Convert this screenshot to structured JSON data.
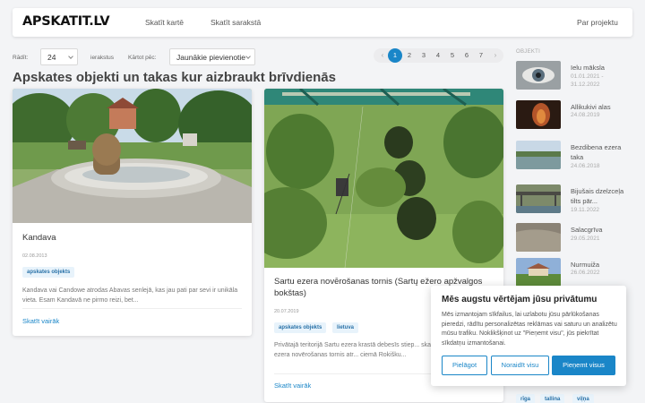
{
  "header": {
    "logo": "APSKATIT.LV",
    "nav": [
      "Skatīt kartē",
      "Skatīt sarakstā"
    ],
    "about": "Par projektu"
  },
  "controls": {
    "show_label": "Rādīt:",
    "show_value": "24",
    "show_suffix": "ierakstus",
    "sort_label": "Kārtot pēc:",
    "sort_value": "Jaunākie pievienotie"
  },
  "pagination": {
    "prev": "‹",
    "pages": [
      "1",
      "2",
      "3",
      "4",
      "5",
      "6",
      "7"
    ],
    "next": "›",
    "active_page": "1"
  },
  "page_title": "Apskates objekti un takas kur aizbraukt brīvdienās",
  "cards": [
    {
      "title": "Kandava",
      "date": "02.08.2013",
      "tags": [
        "apskates objekts"
      ],
      "text": "Kandava vai Candowe atrodas Abavas senlejā, kas jau pati par sevi ir unikāla vieta. Esam Kandavā ne pirmo reizi, bet...",
      "more": "Skatīt vairāk"
    },
    {
      "title": "Sartu ezera novērošanas tornis (Sartų ežero apžvalgos bokštas)",
      "date": "20.07.2019",
      "tags": [
        "apskates objekts",
        "lietuva"
      ],
      "text": "Privātajā teritorijā Sartu ezera krastā debesīs stiep... skatu tornis un Sartu ezera novērošanas tornis atr... ciemā Rokišku...",
      "more": "Skatīt vairāk"
    }
  ],
  "sidebar": {
    "heading": "OBJEKTI",
    "items": [
      {
        "title": "Ielu māksla",
        "date": "01.01.2021 - 31.12.2022"
      },
      {
        "title": "Allikukivi alas",
        "date": "24.08.2019"
      },
      {
        "title": "Bezdibena ezera taka",
        "date": "24.06.2018"
      },
      {
        "title": "Bijušais dzelzceļa tilts pār...",
        "date": "19.11.2022"
      },
      {
        "title": "Salacgrīva",
        "date": "29.05.2021"
      },
      {
        "title": "Nurmuiža",
        "date": "26.06.2022"
      }
    ],
    "tags": [
      "rīga",
      "tallina",
      "viļņa"
    ]
  },
  "cookie": {
    "title": "Mēs augstu vērtējam jūsu privātumu",
    "text": "Mēs izmantojam sīkfailus, lai uzlabotu jūsu pārlūkošanas pieredzi, rādītu personalizētas reklāmas vai saturu un analizētu mūsu trafiku. Noklikšķinot uz \"Pieņemt visu\", jūs piekrītat sīkdatņu izmantošanai.",
    "customize": "Pielāgot",
    "reject": "Noraidīt visu",
    "accept": "Pieņemt visus"
  },
  "colors": {
    "accent": "#1a86c8",
    "tag_bg": "#e8f3fb",
    "page_bg": "#f3f4f6"
  }
}
